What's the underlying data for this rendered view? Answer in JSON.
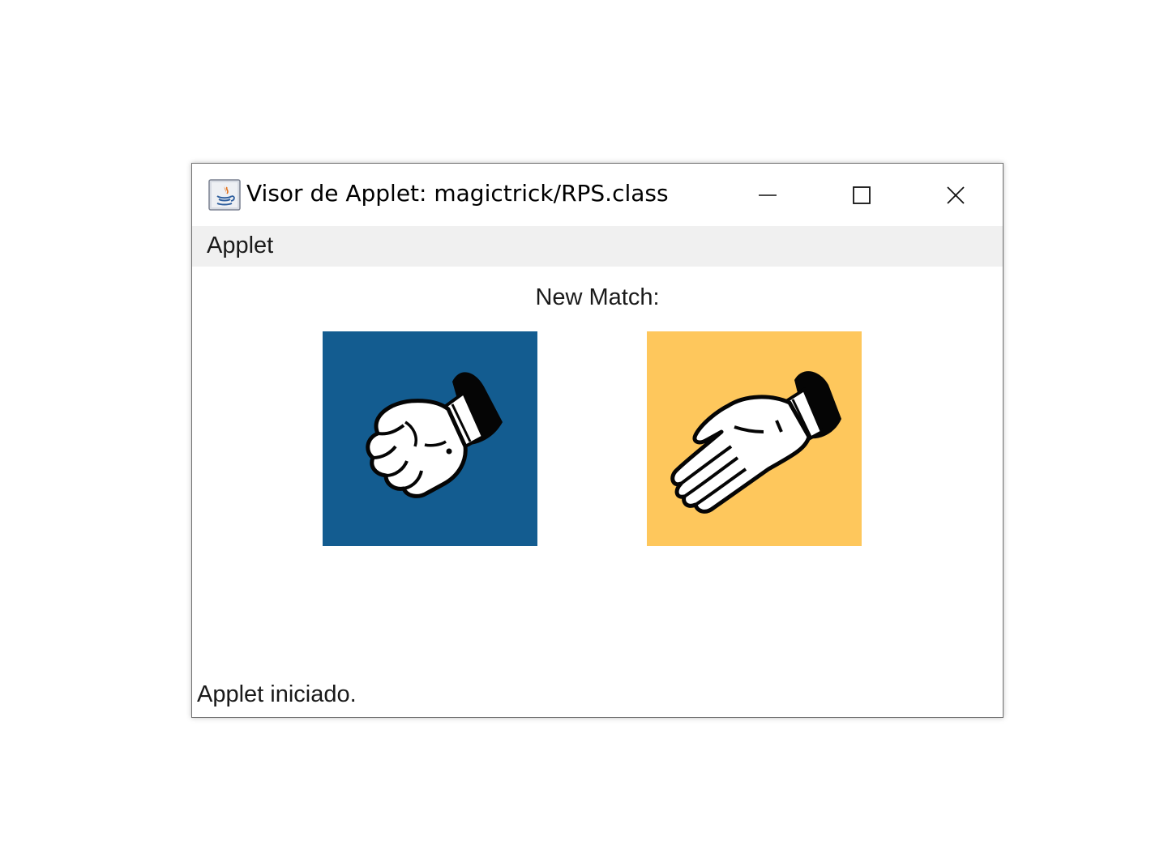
{
  "window": {
    "title": "Visor de Applet: magictrick/RPS.class",
    "icon": "java-icon"
  },
  "menubar": {
    "items": [
      {
        "label": "Applet"
      }
    ]
  },
  "content": {
    "heading": "New Match:",
    "choices": [
      {
        "name": "rock",
        "icon": "fist-icon",
        "background": "#135c90"
      },
      {
        "name": "paper",
        "icon": "open-hand-icon",
        "background": "#fec75c"
      }
    ]
  },
  "status": {
    "text": "Applet iniciado."
  }
}
